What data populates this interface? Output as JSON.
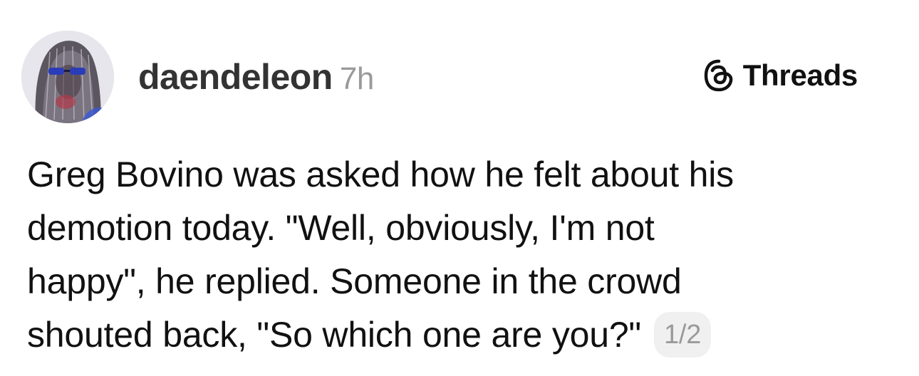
{
  "post": {
    "author": {
      "username": "daendeleon",
      "timestamp": "7h",
      "avatar": "profile-photo"
    },
    "source": {
      "label": "Threads",
      "icon": "threads-logo-icon"
    },
    "lines": [
      "Greg Bovino was asked how he felt about his",
      "demotion today. \"Well, obviously, I'm not",
      "happy\", he replied. Someone in the crowd",
      "shouted back, \"So which one are you?\""
    ],
    "page_indicator": "1/2"
  },
  "colors": {
    "text": "#111111",
    "username": "#333333",
    "muted": "#9a9a9a",
    "pill_background": "#f0f0f0",
    "background": "#ffffff"
  }
}
